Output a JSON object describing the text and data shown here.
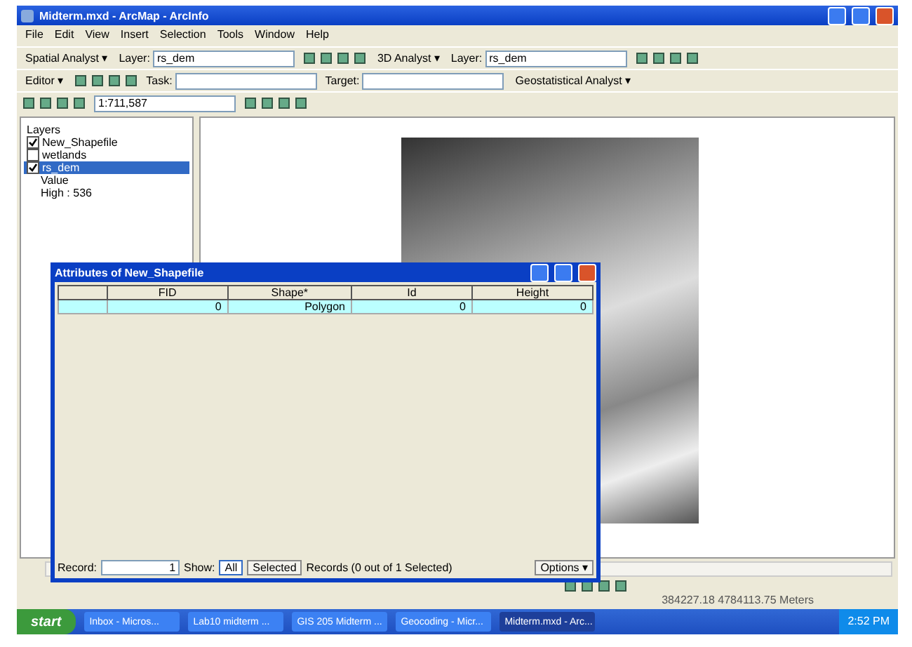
{
  "window": {
    "title": "Midterm.mxd - ArcMap - ArcInfo"
  },
  "menu": [
    "File",
    "Edit",
    "View",
    "Insert",
    "Selection",
    "Tools",
    "Window",
    "Help"
  ],
  "toolbars": [
    [
      {
        "kind": "menu",
        "label": "Spatial Analyst ▾"
      },
      {
        "kind": "field",
        "label": "Layer:",
        "value": "rs_dem"
      },
      {
        "kind": "icons"
      },
      {
        "kind": "menu",
        "label": "3D Analyst ▾"
      },
      {
        "kind": "field",
        "label": "Layer:",
        "value": "rs_dem"
      },
      {
        "kind": "icons"
      }
    ],
    [
      {
        "kind": "menu",
        "label": "Editor ▾"
      },
      {
        "kind": "icons"
      },
      {
        "kind": "field",
        "label": "Task:"
      },
      {
        "kind": "field",
        "label": "Target:"
      },
      {
        "kind": "menu",
        "label": "Geostatistical Analyst ▾"
      }
    ],
    [
      {
        "kind": "icons"
      },
      {
        "kind": "field",
        "value": "1:711,587"
      },
      {
        "kind": "icons"
      }
    ]
  ],
  "toc": {
    "items": [
      {
        "label": "Layers",
        "selected": false,
        "children": [
          {
            "label": "New_Shapefile",
            "checked": true,
            "selected": false
          },
          {
            "label": "wetlands",
            "checked": false,
            "selected": false
          },
          {
            "label": "rs_dem",
            "checked": true,
            "selected": true,
            "children": [
              {
                "label": "Value",
                "selected": false
              },
              {
                "label": "High : 536",
                "selected": false
              }
            ]
          }
        ]
      }
    ]
  },
  "attributes": {
    "title": "Attributes of New_Shapefile",
    "columns": [
      "FID",
      "Shape*",
      "Id",
      "Height"
    ],
    "rows": [
      {
        "cells": [
          "0",
          "Polygon",
          "0",
          "0"
        ],
        "selected": true
      }
    ],
    "footer": {
      "record_label": "Record:",
      "record_value": "1",
      "show_label": "Show:",
      "all_button": "All",
      "all_selected": true,
      "selected_button": "Selected",
      "records": "Records (0 out of 1 Selected)",
      "options": "Options ▾"
    }
  },
  "status_bar": {
    "coordinates": "384227.18  4784113.75 Meters"
  },
  "taskbar": {
    "start": "start",
    "tasks": [
      {
        "label": "Inbox - Micros...",
        "active": false
      },
      {
        "label": "Lab10 midterm ...",
        "active": false
      },
      {
        "label": "GIS 205 Midterm ...",
        "active": false
      },
      {
        "label": "Geocoding - Micr...",
        "active": false
      },
      {
        "label": "Midterm.mxd - Arc...",
        "active": true
      }
    ],
    "clock": "2:52 PM"
  }
}
